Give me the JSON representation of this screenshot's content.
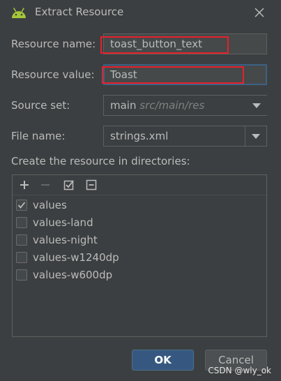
{
  "dialog": {
    "title": "Extract Resource"
  },
  "form": {
    "resource_name_label": "Resource name:",
    "resource_name_value": "toast_button_text",
    "resource_value_label": "Resource value:",
    "resource_value_value": "Toast",
    "source_set_label": "Source set:",
    "source_set_value": "main",
    "source_set_path": "src/main/res",
    "file_name_label": "File name:",
    "file_name_value": "strings.xml",
    "directories_label": "Create the resource in directories:"
  },
  "directories": [
    {
      "label": "values",
      "checked": true
    },
    {
      "label": "values-land",
      "checked": false
    },
    {
      "label": "values-night",
      "checked": false
    },
    {
      "label": "values-w1240dp",
      "checked": false
    },
    {
      "label": "values-w600dp",
      "checked": false
    }
  ],
  "buttons": {
    "ok": "OK",
    "cancel": "Cancel"
  },
  "watermark": "CSDN @wly_ok",
  "colors": {
    "accent": "#365880",
    "highlight": "#e8202a",
    "focus": "#3d6185"
  }
}
